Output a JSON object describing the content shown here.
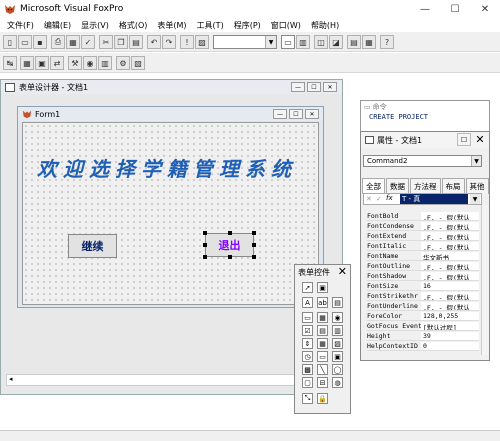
{
  "app": {
    "title": "Microsoft Visual FoxPro"
  },
  "window_controls": {
    "minimize": "—",
    "maximize": "☐",
    "close": "✕"
  },
  "menu": [
    "文件(F)",
    "编辑(E)",
    "显示(V)",
    "格式(O)",
    "表单(M)",
    "工具(T)",
    "程序(P)",
    "窗口(W)",
    "帮助(H)"
  ],
  "form_designer": {
    "title": "表单设计器 - 文档1",
    "form_title": "Form1",
    "banner": "欢迎选择学籍管理系统",
    "continue_button": "继续",
    "exit_button": "退出"
  },
  "command_window": {
    "title": "命令",
    "command": "CREATE PROJECT"
  },
  "properties": {
    "title": "属性 - 文档1",
    "object": "Command2",
    "tabs": [
      "全部",
      "数据",
      "方法程",
      "布局",
      "其他"
    ],
    "edit_value": "T - 真",
    "rows": [
      {
        "name": "FontBold",
        "value": ".F. - 假(默认"
      },
      {
        "name": "FontCondense",
        "value": ".F. - 假(默认"
      },
      {
        "name": "FontExtend",
        "value": ".F. - 假(默认"
      },
      {
        "name": "FontItalic",
        "value": ".F. - 假(默认"
      },
      {
        "name": "FontName",
        "value": "华文新书"
      },
      {
        "name": "FontOutline",
        "value": ".F. - 假(默认"
      },
      {
        "name": "FontShadow",
        "value": ".F. - 假(默认"
      },
      {
        "name": "FontSize",
        "value": "16"
      },
      {
        "name": "FontStrikethr",
        "value": ".F. - 假(默认"
      },
      {
        "name": "FontUnderline",
        "value": ".F. - 假(默认"
      },
      {
        "name": "ForeColor",
        "value": "128,0,255"
      },
      {
        "name": "GotFocus Event",
        "value": "[默认过程]"
      },
      {
        "name": "Height",
        "value": "39"
      },
      {
        "name": "HelpContextID",
        "value": "0"
      }
    ]
  },
  "toolbox": {
    "title": "表单控件"
  },
  "colors": {
    "banner": "#1f5fb4",
    "exit_text": "#8000ff",
    "accent": "#0a246a"
  }
}
